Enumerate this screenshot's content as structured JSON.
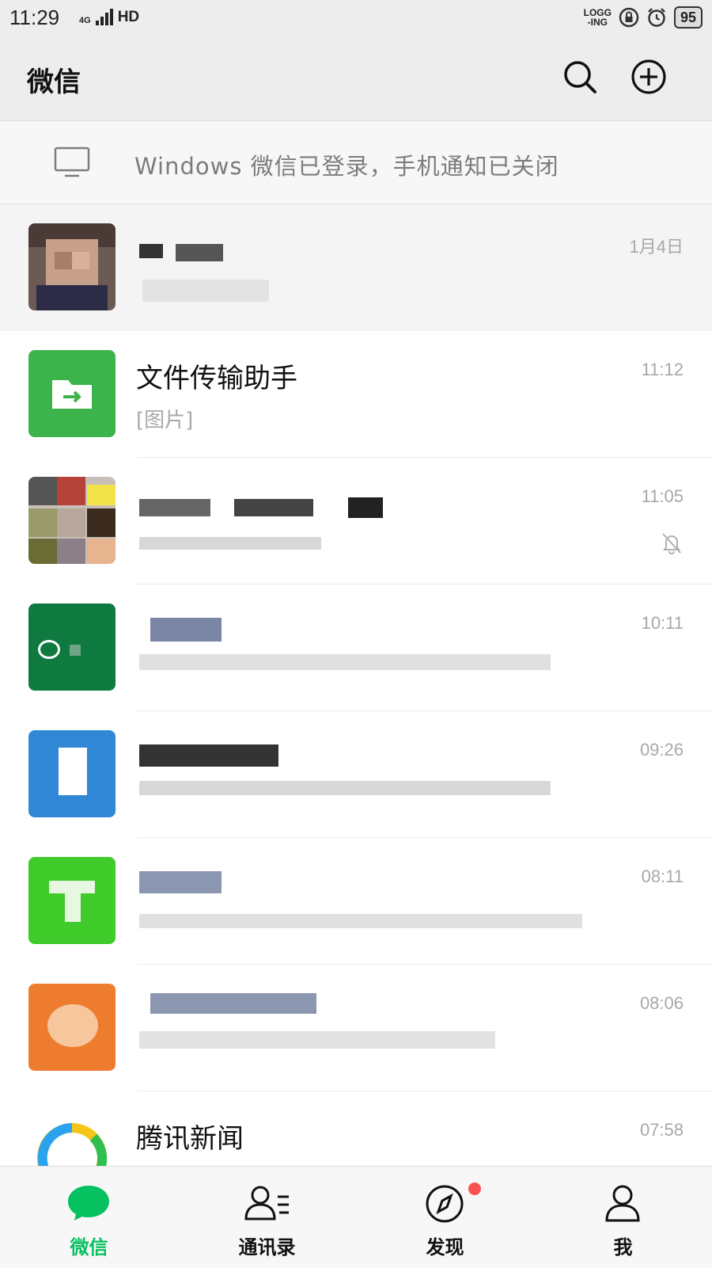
{
  "status_bar": {
    "time": "11:29",
    "network": "4G",
    "hd": "HD",
    "logging_line1": "LOGG",
    "logging_line2": "-ING",
    "battery": "95"
  },
  "header": {
    "title": "微信",
    "search_icon": "search-icon",
    "add_icon": "plus-circle-icon"
  },
  "notice": {
    "icon": "desktop-monitor-icon",
    "text": "Windows 微信已登录，手机通知已关闭"
  },
  "chats": [
    {
      "name": "",
      "preview": "",
      "time": "1月4日",
      "pinned": true
    },
    {
      "name": "文件传输助手",
      "preview": "[图片]",
      "time": "11:12"
    },
    {
      "name": "",
      "preview": "",
      "time": "11:05",
      "muted": true
    },
    {
      "name": "",
      "preview": "",
      "time": "10:11"
    },
    {
      "name": "",
      "preview": "",
      "time": "09:26"
    },
    {
      "name": "",
      "preview": "",
      "time": "08:11"
    },
    {
      "name": "",
      "preview": "",
      "time": "08:06"
    },
    {
      "name": "腾讯新闻",
      "preview": "",
      "time": "07:58"
    }
  ],
  "tabs": [
    {
      "label": "微信",
      "icon": "chat-bubble-icon",
      "active": true
    },
    {
      "label": "通讯录",
      "icon": "contacts-icon"
    },
    {
      "label": "发现",
      "icon": "compass-icon",
      "badge": true
    },
    {
      "label": "我",
      "icon": "person-icon"
    }
  ],
  "colors": {
    "accent": "#07c160",
    "badge": "#fa5151",
    "header_bg": "#ededed"
  }
}
